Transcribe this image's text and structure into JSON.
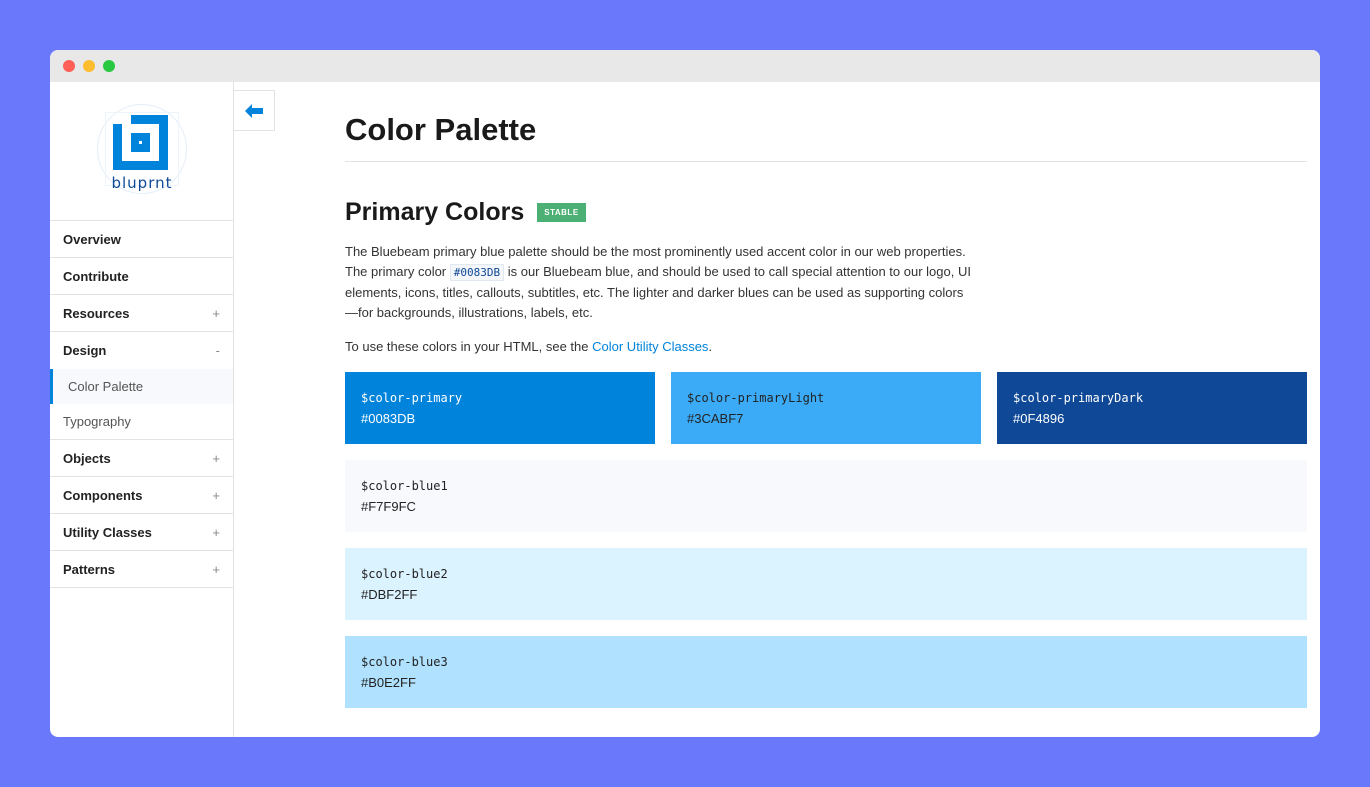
{
  "window": {
    "dots": [
      "#ff5f57",
      "#febc2e",
      "#28c840"
    ]
  },
  "logo": {
    "text": "bluprnt"
  },
  "sidebar": {
    "items": [
      {
        "label": "Overview",
        "sign": ""
      },
      {
        "label": "Contribute",
        "sign": ""
      },
      {
        "label": "Resources",
        "sign": "+"
      },
      {
        "label": "Design",
        "sign": "-"
      },
      {
        "label": "Color Palette"
      },
      {
        "label": "Typography"
      },
      {
        "label": "Objects",
        "sign": "+"
      },
      {
        "label": "Components",
        "sign": "+"
      },
      {
        "label": "Utility Classes",
        "sign": "+"
      },
      {
        "label": "Patterns",
        "sign": "+"
      }
    ]
  },
  "back_button": {
    "icon": "arrow-left-icon"
  },
  "main": {
    "title": "Color Palette",
    "section_title": "Primary Colors",
    "badge": "STABLE",
    "desc_part1": "The Bluebeam primary blue palette should be the most prominently used accent color in our web properties. The primary color ",
    "desc_code": "#0083DB",
    "desc_part2": " is our Bluebeam blue, and should be used to call special attention to our logo, UI elements, icons, titles, callouts, subtitles, etc. The lighter and darker blues can be used as supporting colors —for backgrounds, illustrations, labels, etc.",
    "para2_prefix": "To use these colors in your HTML, see the ",
    "para2_link": "Color Utility Classes",
    "para2_suffix": "."
  },
  "swatches": [
    {
      "name": "$color-primary",
      "hex": "#0083DB"
    },
    {
      "name": "$color-primaryLight",
      "hex": "#3CABF7"
    },
    {
      "name": "$color-primaryDark",
      "hex": "#0F4896"
    },
    {
      "name": "$color-blue1",
      "hex": "#F7F9FC"
    },
    {
      "name": "$color-blue2",
      "hex": "#DBF2FF"
    },
    {
      "name": "$color-blue3",
      "hex": "#B0E2FF"
    }
  ],
  "colors": {
    "accent": "#0083DB",
    "badge": "#4caf73",
    "background": "#6a78fb"
  }
}
